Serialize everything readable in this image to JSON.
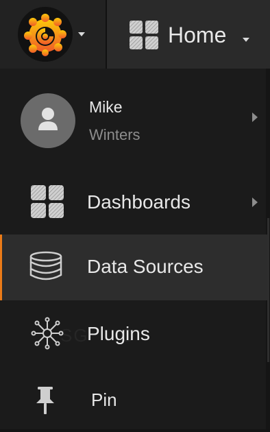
{
  "topbar": {
    "logo_icon": "grafana-logo-icon",
    "dashboard_icon": "dashboard-grid-icon",
    "title": "Home"
  },
  "user": {
    "first_name": "Mike",
    "last_name": "Winters",
    "avatar_icon": "user-avatar-icon"
  },
  "menu": {
    "items": [
      {
        "label": "Dashboards",
        "icon": "dashboards-icon",
        "has_submenu": true
      },
      {
        "label": "Data Sources",
        "icon": "database-icon",
        "active": true
      },
      {
        "label": "Plugins",
        "icon": "plugins-icon"
      },
      {
        "label": "Pin",
        "icon": "pin-icon"
      }
    ]
  },
  "colors": {
    "accent": "#eb7b18",
    "background": "#1b1b1b",
    "active_row": "#2d2d2d",
    "text": "#e8e8e8",
    "muted_text": "#8d8d8d"
  }
}
